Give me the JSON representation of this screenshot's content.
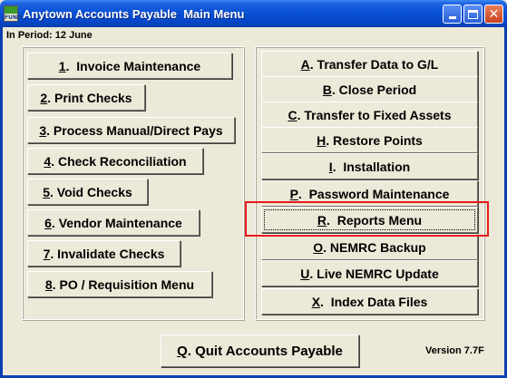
{
  "window": {
    "title": "Anytown Accounts Payable  Main Menu",
    "icon_label": "FUND",
    "minimize_icon": "minimize-icon",
    "maximize_icon": "maximize-icon",
    "close_icon": "close-icon"
  },
  "period": {
    "label": "In Period: 12 June"
  },
  "left_menu": [
    {
      "key": "1",
      "label": ".  Invoice Maintenance"
    },
    {
      "key": "2",
      "label": ". Print Checks"
    },
    {
      "key": "3",
      "label": ". Process Manual/Direct Pays"
    },
    {
      "key": "4",
      "label": ". Check Reconciliation"
    },
    {
      "key": "5",
      "label": ". Void Checks"
    },
    {
      "key": "6",
      "label": ". Vendor Maintenance"
    },
    {
      "key": "7",
      "label": ". Invalidate Checks"
    },
    {
      "key": "8",
      "label": ". PO / Requisition Menu"
    }
  ],
  "right_menu": [
    {
      "key": "A",
      "label": ". Transfer Data to G/L"
    },
    {
      "key": "B",
      "label": ". Close Period"
    },
    {
      "key": "C",
      "label": ". Transfer to Fixed Assets"
    },
    {
      "key": "H",
      "label": ". Restore Points"
    },
    {
      "key": "I",
      "label": ".  Installation"
    },
    {
      "key": "P",
      "label": ".  Password Maintenance"
    },
    {
      "key": "R",
      "label": ".  Reports Menu"
    },
    {
      "key": "O",
      "label": ". NEMRC Backup"
    },
    {
      "key": "U",
      "label": ". Live NEMRC Update"
    },
    {
      "key": "X",
      "label": ".  Index Data Files"
    }
  ],
  "quit_button": {
    "key": "Q",
    "label": ". Quit Accounts Payable"
  },
  "version": {
    "label": "Version 7.7F"
  },
  "colors": {
    "titlebar": "#0a52d6",
    "highlight": "#e8191c",
    "face": "#ece9d8"
  }
}
